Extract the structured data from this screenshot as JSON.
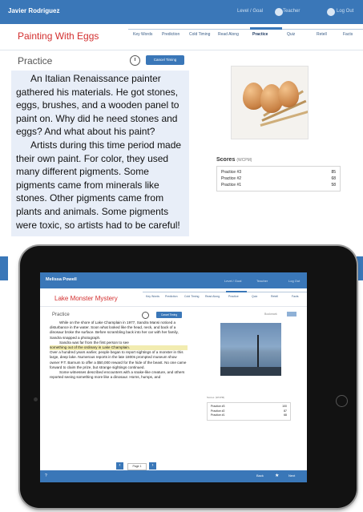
{
  "app": {
    "user": "Javier Rodriguez",
    "lesson_title": "Painting With Eggs",
    "tabs": [
      "Key Words",
      "Prediction",
      "Cold Timing",
      "Read Along",
      "Practice",
      "Quiz",
      "Retell",
      "Facts"
    ],
    "active_tab": "Practice",
    "header_links": {
      "level": "Level / Goal",
      "teacher": "Teacher",
      "logout": "Log Out"
    },
    "icons": [
      "chevron-down-icon",
      "teacher-icon",
      "user-icon",
      "clock-icon"
    ]
  },
  "practice": {
    "label": "Practice",
    "cancel_button": "Cancel Timing",
    "paragraphs": [
      "An Italian Renaissance painter gathered his materials. He got stones, eggs, brushes, and a wooden panel to paint on. Why did he need stones and eggs? And what about his paint?",
      "Artists during this time period made their own paint. For color, they used many different pigments. Some pigments came from minerals like stones. Other pigments came from plants and animals. Some pigments were toxic, so artists had to be careful!"
    ]
  },
  "scores": {
    "title": "Scores",
    "unit": "(WCPM)",
    "rows": [
      {
        "label": "Practice #3",
        "value": "85"
      },
      {
        "label": "Practice #2",
        "value": "68"
      },
      {
        "label": "Practice #1",
        "value": "58"
      }
    ]
  },
  "ipad_screen": {
    "user": "Melissa Powell",
    "lesson_title": "Lake Monster Mystery",
    "tabs": [
      "Key Words",
      "Prediction",
      "Cold Timing",
      "Read Along",
      "Practice",
      "Quiz",
      "Retell",
      "Facts"
    ],
    "practice_label": "Practice",
    "cancel_button": "Cancel Timing",
    "bookmark_label": "Bookmark",
    "paragraphs": [
      "While on the shore of Lake Champlain in 1977, Sandra Mansi noticed a disturbance in the water. Soon what looked like the head, neck, and back of a dinosaur broke the surface. Before scrambling back into her car with her family, Sandra snapped a photograph.",
      "Sandra was far from the first person to see",
      "something out of the ordinary in Lake Champlain.",
      "Over a hundred years earlier, people began to report sightings of a monster in this large, deep lake. Numerous reports in the late 1800s prompted museum show owner P.T. Barnum to offer a $50,000 reward for the hide of the beast. No one came forward to claim the prize, but strange sightings continued.",
      "Some witnesses described encounters with a snake-like creature, and others reported seeing something more like a dinosaur. Horns, humps, and"
    ],
    "pager": "Page 1",
    "scores_title": "Scores",
    "scores_unit": "(WCPM)",
    "scores": [
      {
        "label": "Practice #3",
        "value": "100"
      },
      {
        "label": "Practice #2",
        "value": "87"
      },
      {
        "label": "Practice #1",
        "value": "68"
      }
    ],
    "bottom": {
      "help": "?",
      "back": "Back",
      "next": "Next"
    }
  }
}
